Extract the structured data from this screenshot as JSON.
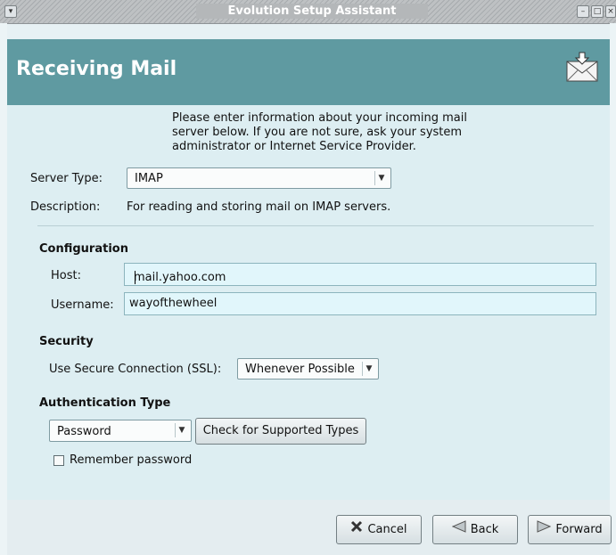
{
  "window": {
    "title": "Evolution Setup Assistant",
    "menu_icon": "window-menu-icon",
    "controls": [
      "minimize-icon",
      "maximize-icon",
      "close-icon"
    ]
  },
  "page": {
    "heading": "Receiving Mail",
    "icon": "mail-envelope-icon",
    "header_color": "#5f9aa1"
  },
  "intro_text": "Please enter information about your incoming mail server below. If you are not sure, ask your system administrator or Internet Service Provider.",
  "server_type": {
    "label": "Server Type:",
    "value": "IMAP"
  },
  "description": {
    "label": "Description:",
    "value": "For reading and storing mail on IMAP servers."
  },
  "configuration": {
    "heading": "Configuration",
    "host_label": "Host:",
    "host_value": "mail.yahoo.com",
    "username_label": "Username:",
    "username_value": "wayofthewheel"
  },
  "security": {
    "heading": "Security",
    "ssl_label": "Use Secure Connection (SSL):",
    "ssl_value": "Whenever Possible"
  },
  "authentication": {
    "heading": "Authentication Type",
    "type_value": "Password",
    "check_button": "Check for Supported Types",
    "remember_label": "Remember password",
    "remember_checked": false
  },
  "buttons": {
    "cancel": "Cancel",
    "back": "Back",
    "forward": "Forward"
  }
}
